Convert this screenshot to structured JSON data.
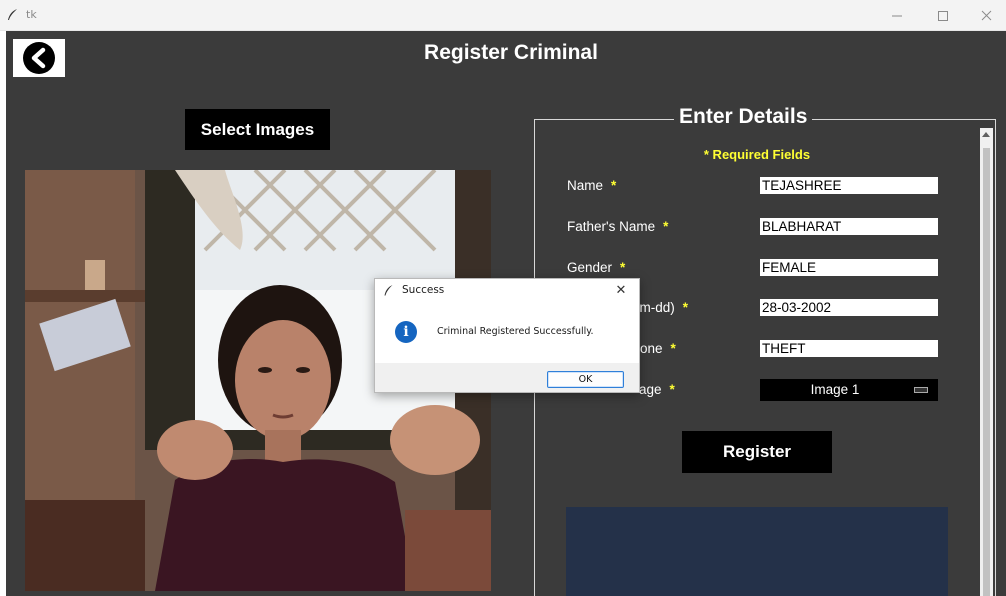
{
  "window": {
    "title": "tk",
    "controls": {
      "minimize": "—",
      "maximize": "☐",
      "close": "✕"
    }
  },
  "header": {
    "back_icon": "back-arrow-icon",
    "title": "Register Criminal"
  },
  "left_panel": {
    "select_images_label": "Select Images"
  },
  "details": {
    "legend": "Enter Details",
    "required_note": "* Required Fields",
    "fields": [
      {
        "label": "Name",
        "required": "*",
        "value": "TEJASHREE"
      },
      {
        "label": "Father's Name",
        "required": "*",
        "value": "BLABHARAT"
      },
      {
        "label": "Gender",
        "required": "*",
        "value": "FEMALE"
      },
      {
        "label": "y-mm-dd)",
        "required": "*",
        "value": "28-03-2002"
      },
      {
        "label": "one",
        "required": "*",
        "value": "THEFT"
      },
      {
        "label": "age",
        "required": "*",
        "value": "Image 1"
      }
    ],
    "register_label": "Register"
  },
  "dialog": {
    "title": "Success",
    "close": "✕",
    "icon": "info-icon",
    "icon_glyph": "i",
    "message": "Criminal Registered Successfully.",
    "ok_label": "OK"
  },
  "colors": {
    "background": "#3b3b3b",
    "button": "#000000",
    "required": "#ffff33",
    "info_panel": "#243149",
    "dialog_accent": "#2f7fd8"
  }
}
